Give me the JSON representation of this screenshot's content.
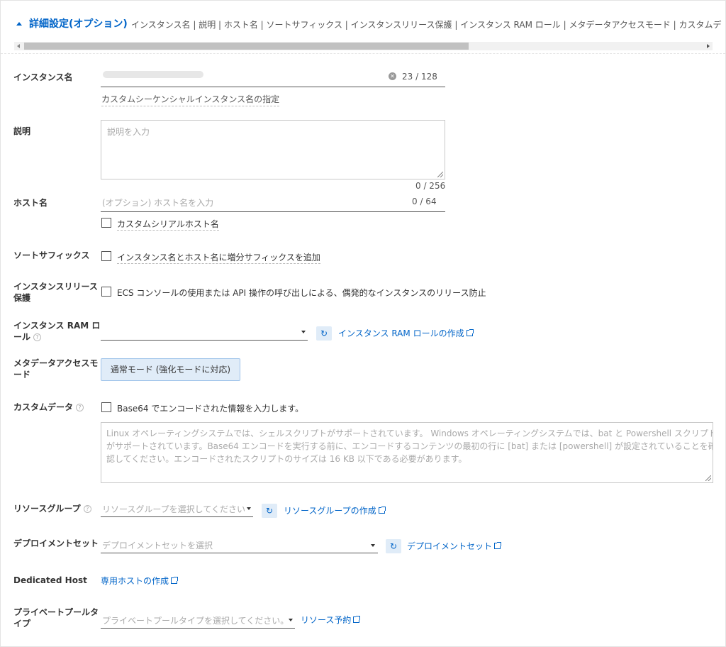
{
  "header": {
    "title": "詳細設定(オプション)",
    "crumbs": "インスタンス名 | 説明 | ホスト名 | ソートサフィックス | インスタンスリリース保護 | インスタンス RAM ロール | メタデータアクセスモード | カスタムデ"
  },
  "instance_name": {
    "label": "インスタンス名",
    "count": "23 / 128",
    "hint": "カスタムシーケンシャルインスタンス名の指定"
  },
  "description": {
    "label": "説明",
    "placeholder": "説明を入力",
    "count": "0 / 256"
  },
  "hostname": {
    "label": "ホスト名",
    "placeholder": "(オプション) ホスト名を入力",
    "count": "0 / 64",
    "checkbox_label": "カスタムシリアルホスト名"
  },
  "sort_suffix": {
    "label": "ソートサフィックス",
    "checkbox_label": "インスタンス名とホスト名に増分サフィックスを追加"
  },
  "release_protection": {
    "label_line1": "インスタンスリリース",
    "label_line2": "保護",
    "checkbox_label": "ECS コンソールの使用または API 操作の呼び出しによる、偶発的なインスタンスのリリース防止"
  },
  "ram_role": {
    "label_line1": "インスタンス RAM ロ",
    "label_line2": "ール",
    "create_link": "インスタンス RAM ロールの作成"
  },
  "metadata_mode": {
    "label_line1": "メタデータアクセスモ",
    "label_line2": "ード",
    "button": "通常モード (強化モードに対応)"
  },
  "custom_data": {
    "label": "カスタムデータ",
    "checkbox_label": "Base64 でエンコードされた情報を入力します。",
    "placeholder_line1": "Linux オペレーティングシステムでは、シェルスクリプトがサポートされています。 Windows オペレーティングシステムでは、bat と Powershell スクリプト",
    "placeholder_line2": "がサポートされています。Base64 エンコードを実行する前に、エンコードするコンテンツの最初の行に [bat] または [powershell] が設定されていることを確",
    "placeholder_line3": "認してください。エンコードされたスクリプトのサイズは 16 KB 以下である必要があります。"
  },
  "resource_group": {
    "label": "リソースグループ",
    "placeholder": "リソースグループを選択してください",
    "create_link": "リソースグループの作成"
  },
  "deployment_set": {
    "label": "デプロイメントセット",
    "placeholder": "デプロイメントセットを選択",
    "create_link": "デプロイメントセット"
  },
  "dedicated_host": {
    "label": "Dedicated Host",
    "create_link": "専用ホストの作成"
  },
  "private_pool": {
    "label_line1": "プライベートプールタ",
    "label_line2": "イプ",
    "placeholder": "プライベートプールタイプを選択してください。",
    "reserve_link": "リソース予約"
  },
  "colors": {
    "accent": "#0064c8",
    "button_bg": "#e0ecf8"
  }
}
